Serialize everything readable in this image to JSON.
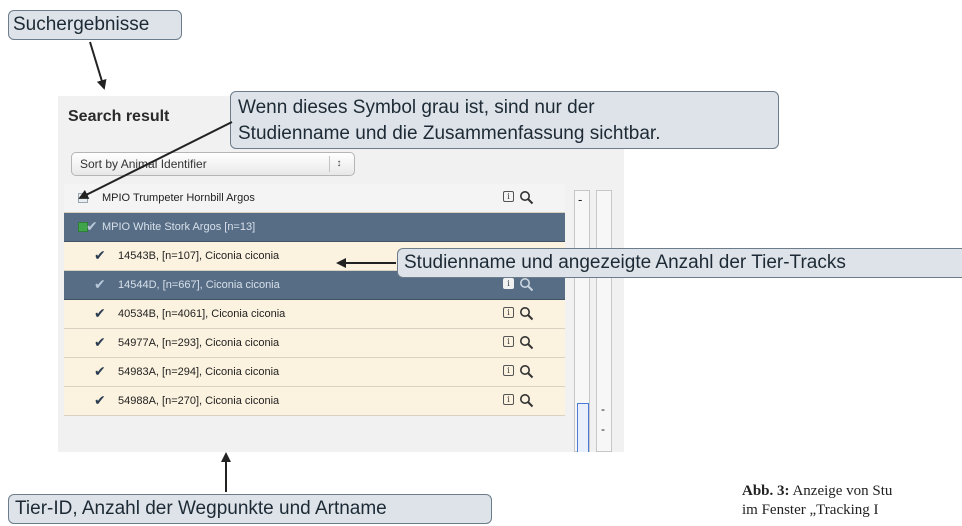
{
  "callouts": {
    "search_results": "Suchergebnisse",
    "symbol_line1": "Wenn dieses Symbol grau ist, sind nur der",
    "symbol_line2": "Studienname und die Zusammenfassung sichtbar.",
    "study_count": "Studienname und angezeigte Anzahl der Tier-Tracks",
    "tier_id": "Tier-ID, Anzahl der Wegpunkte und Artname"
  },
  "panel": {
    "title": "Search result",
    "sort_select": "Sort by Animal Identifier",
    "sort_stepper": "↕"
  },
  "icons": {
    "info": "i",
    "search": "magnifier-icon",
    "check": "✔",
    "minus": "-"
  },
  "colors": {
    "selected_row": "#576d85",
    "track_row": "#fbf2df",
    "callout_fill": "#dde3e8",
    "visible_green": "#3fa44a"
  },
  "rows": [
    {
      "kind": "study",
      "label": "MPIO Trumpeter Hornbill Argos",
      "checked": false,
      "selected": false
    },
    {
      "kind": "study",
      "label": "MPIO White Stork Argos [n=13]",
      "checked": true,
      "selected": true
    },
    {
      "kind": "track",
      "label": "14543B, [n=107], Ciconia ciconia",
      "checked": true,
      "selected": false
    },
    {
      "kind": "track",
      "label": "14544D, [n=667], Ciconia ciconia",
      "checked": true,
      "selected": true
    },
    {
      "kind": "track",
      "label": "40534B, [n=4061], Ciconia ciconia",
      "checked": true,
      "selected": false
    },
    {
      "kind": "track",
      "label": "54977A, [n=293], Ciconia ciconia",
      "checked": true,
      "selected": false
    },
    {
      "kind": "track",
      "label": "54983A, [n=294], Ciconia ciconia",
      "checked": true,
      "selected": false
    },
    {
      "kind": "track",
      "label": "54988A, [n=270], Ciconia ciconia",
      "checked": true,
      "selected": false
    }
  ],
  "caption": {
    "label": "Abb. 3:",
    "line1": "Anzeige von Stu",
    "line2": "im Fenster „Tracking I"
  }
}
